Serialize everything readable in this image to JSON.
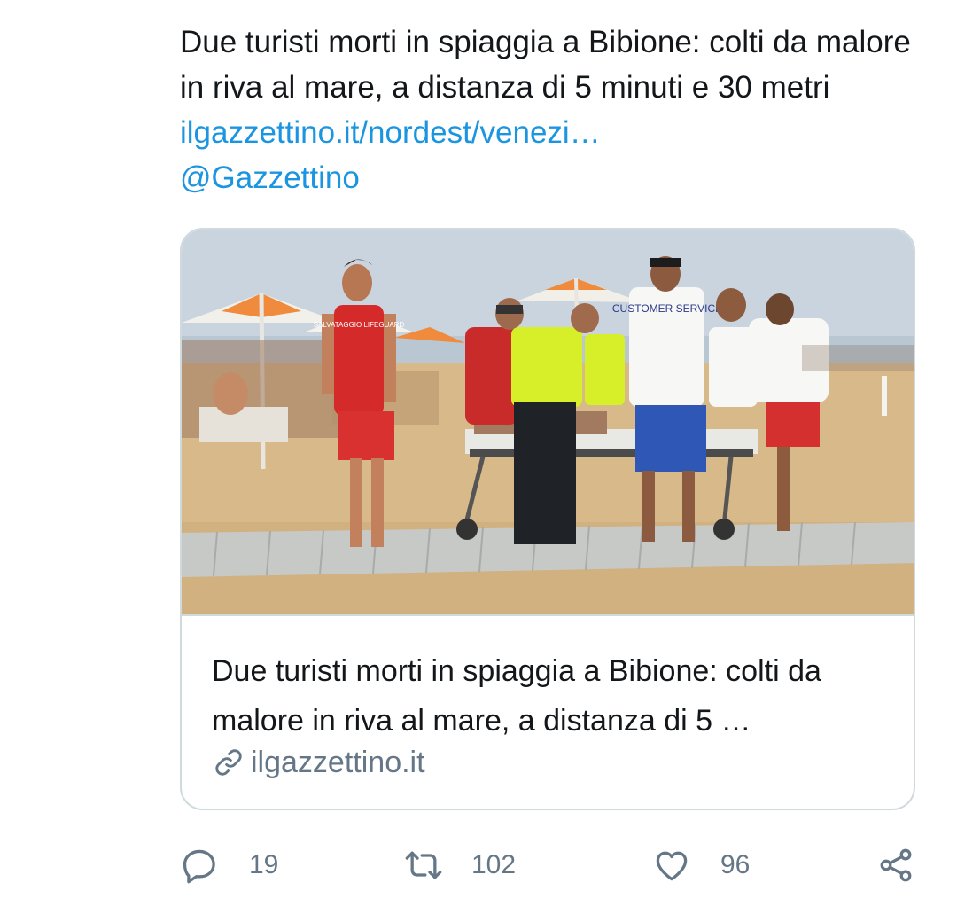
{
  "tweet": {
    "text": "Due turisti morti in spiaggia a Bibione: colti da malore in riva al mare, a distanza di 5 minuti e 30 metri",
    "link_text": "ilgazzettino.it/nordest/venezi…",
    "mention": "@Gazzettino"
  },
  "card": {
    "image_name": "beach-rescue-photo",
    "title": "Due turisti morti in spiaggia a Bibione: colti da malore in riva al mare, a distanza di 5 …",
    "domain": "ilgazzettino.it",
    "shirt_texts": {
      "lifeguard": "SALVATAGGIO LIFEGUARD",
      "service": "CUSTOMER SERVICE"
    }
  },
  "actions": {
    "reply_count": "19",
    "retweet_count": "102",
    "like_count": "96"
  },
  "colors": {
    "text": "#14171a",
    "link": "#1b95e0",
    "muted": "#657786",
    "border": "#cfd9de"
  }
}
